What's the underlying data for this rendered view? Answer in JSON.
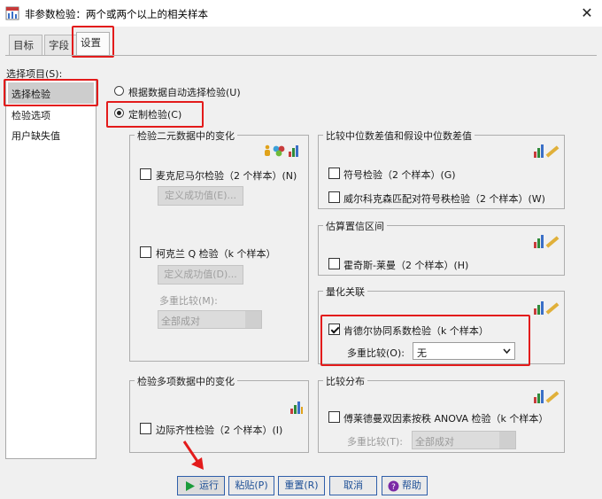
{
  "window": {
    "title": "非参数检验：两个或两个以上的相关样本",
    "close": "✕"
  },
  "tabs": [
    {
      "label": "目标",
      "active": false
    },
    {
      "label": "字段",
      "active": false
    },
    {
      "label": "设置",
      "active": true
    }
  ],
  "select_items": {
    "label": "选择项目(S):",
    "items": [
      {
        "label": "选择检验",
        "selected": true
      },
      {
        "label": "检验选项",
        "selected": false
      },
      {
        "label": "用户缺失值",
        "selected": false
      }
    ]
  },
  "mode": {
    "auto": {
      "label": "根据数据自动选择检验(U)",
      "checked": false
    },
    "custom": {
      "label": "定制检验(C)",
      "checked": true
    }
  },
  "binary": {
    "title": "检验二元数据中的变化",
    "mcnemar": {
      "label": "麦克尼马尔检验（2 个样本）(N)",
      "checked": false,
      "button": "定义成功值(E)..."
    },
    "cochran": {
      "label": "柯克兰 Q 检验（k 个样本）",
      "checked": false,
      "button": "定义成功值(D)...",
      "multiple_label": "多重比较(M):",
      "multiple_value": "全部成对"
    }
  },
  "multinomial": {
    "title": "检验多项数据中的变化",
    "marginal": {
      "label": "边际齐性检验（2 个样本）(I)",
      "checked": false
    }
  },
  "median": {
    "title": "比较中位数差值和假设中位数差值",
    "sign": {
      "label": "符号检验（2 个样本）(G)",
      "checked": false
    },
    "wilcoxon": {
      "label": "威尔科克森匹配对符号秩检验（2 个样本）(W)",
      "checked": false
    }
  },
  "ci": {
    "title": "估算置信区间",
    "hodges": {
      "label": "霍奇斯-莱曼（2 个样本）(H)",
      "checked": false
    }
  },
  "assoc": {
    "title": "量化关联",
    "kendall": {
      "label": "肯德尔协同系数检验（k 个样本）",
      "checked": true
    },
    "multiple_label": "多重比较(O):",
    "multiple_value": "无"
  },
  "dist": {
    "title": "比较分布",
    "friedman": {
      "label": "傅莱德曼双因素按秩 ANOVA 检验（k 个样本）",
      "checked": false,
      "multiple_label": "多重比较(T):",
      "multiple_value": "全部成对"
    }
  },
  "footer": {
    "run": "运行",
    "paste": "粘贴(P)",
    "reset": "重置(R)",
    "cancel": "取消",
    "help": "帮助"
  },
  "colors": {
    "highlight": "#e31b1b",
    "run_arrow": "#1a9b3a",
    "button_text": "#1d4f96",
    "help_icon": "#7b2aa6"
  },
  "icons": {
    "window": "spss-app-icon",
    "group_chart": "bar-chart-ruler-icon",
    "binary_shapes": "measurement-level-icon",
    "help": "help-icon",
    "run": "play-icon"
  }
}
